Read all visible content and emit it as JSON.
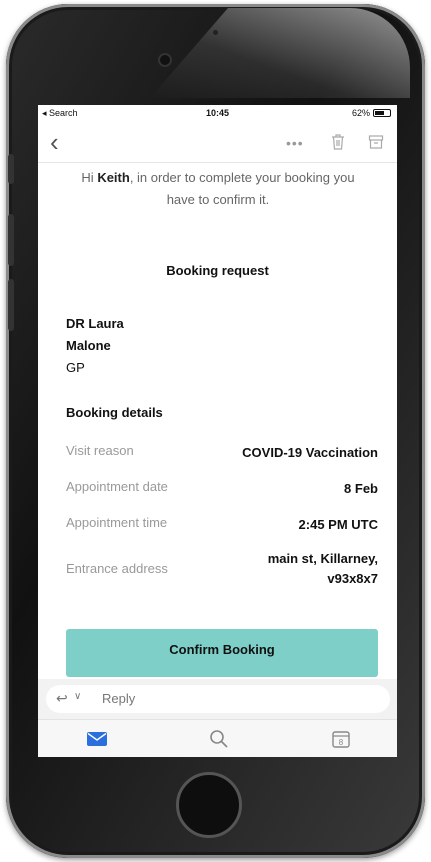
{
  "status_bar": {
    "carrier": "◂ Search",
    "time": "10:45",
    "battery": "62%"
  },
  "toolbar": {
    "more_label": "•••"
  },
  "email": {
    "greeting_pre": "Hi ",
    "greeting_name": "Keith",
    "greeting_post": ", in order to complete your booking you have to confirm it.",
    "section_title": "Booking request",
    "doctor_name_line1": "DR Laura",
    "doctor_name_line2": "Malone",
    "doctor_role": "GP",
    "details_title": "Booking details",
    "details": [
      {
        "label": "Visit reason",
        "value": "COVID-19 Vaccination"
      },
      {
        "label": "Appointment date",
        "value": "8 Feb"
      },
      {
        "label": "Appointment time",
        "value": "2:45 PM UTC"
      },
      {
        "label": "Entrance address",
        "value": "main st, Killarney, v93x8x7"
      }
    ],
    "confirm_label": "Confirm Booking"
  },
  "reply": {
    "placeholder": "Reply"
  },
  "colors": {
    "accent": "#7ecfc8",
    "mail_blue": "#2a6fdb"
  }
}
